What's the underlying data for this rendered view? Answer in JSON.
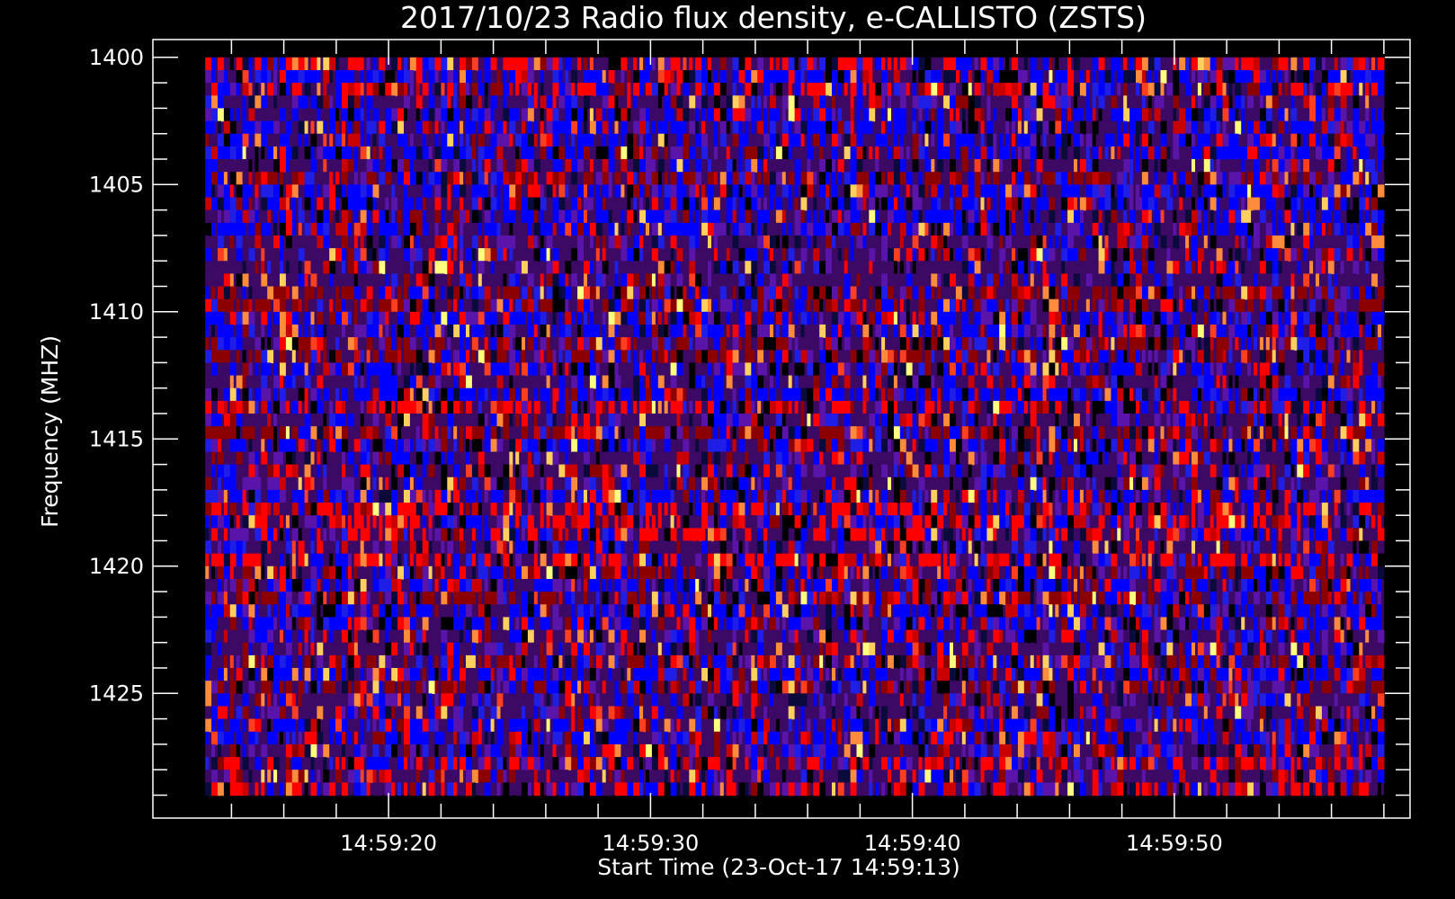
{
  "chart_data": {
    "type": "heatmap",
    "title": "2017/10/23  Radio flux density, e-CALLISTO (ZSTS)",
    "xlabel": "Start Time (23-Oct-17 14:59:13)",
    "ylabel": "Frequency (MHZ)",
    "x_unit": "time",
    "x_range": [
      "14:59:13",
      "14:59:58"
    ],
    "xlim": [
      "14:59:11",
      "14:59:59"
    ],
    "y_range": [
      1400,
      1429
    ],
    "ylim": [
      1399.3,
      1429.9
    ],
    "y_inverted": true,
    "x_tick_labels": [
      "14:59:20",
      "14:59:30",
      "14:59:40",
      "14:59:50"
    ],
    "y_tick_labels": [
      "1400",
      "1405",
      "1410",
      "1415",
      "1420",
      "1425"
    ],
    "colormap": [
      "#000000",
      "#0a0a3c",
      "#3c0a64",
      "#5a14aa",
      "#0000ff",
      "#1e1ee6",
      "#8c0000",
      "#c80000",
      "#ff0000",
      "#ff4020",
      "#ff8c3c",
      "#ffd060",
      "#ffff80"
    ],
    "grid": false,
    "legend": "none"
  }
}
